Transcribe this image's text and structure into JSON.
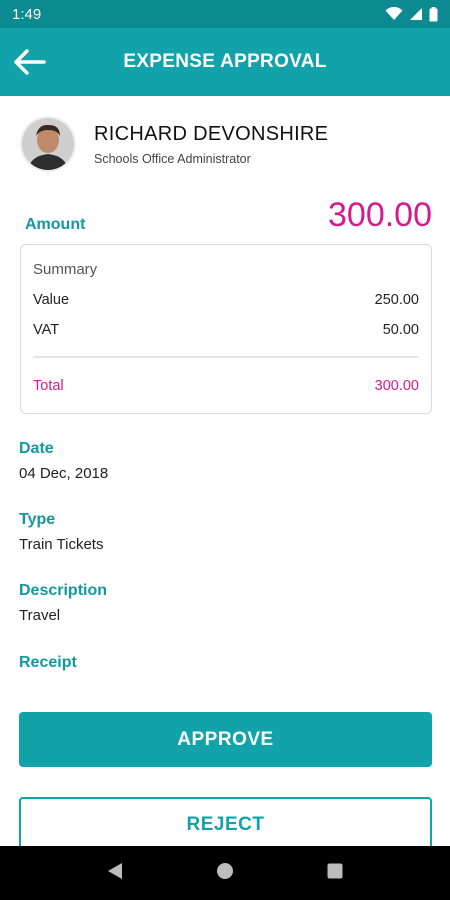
{
  "status_bar": {
    "time": "1:49"
  },
  "app_bar": {
    "title": "EXPENSE APPROVAL"
  },
  "profile": {
    "name": "RICHARD DEVONSHIRE",
    "role": "Schools Office Administrator"
  },
  "amount": {
    "label": "Amount",
    "value": "300.00"
  },
  "summary": {
    "title": "Summary",
    "rows": [
      {
        "label": "Value",
        "value": "250.00"
      },
      {
        "label": "VAT",
        "value": "50.00"
      }
    ],
    "total": {
      "label": "Total",
      "value": "300.00"
    }
  },
  "fields": {
    "date": {
      "label": "Date",
      "value": "04 Dec, 2018"
    },
    "type": {
      "label": "Type",
      "value": "Train Tickets"
    },
    "description": {
      "label": "Description",
      "value": "Travel"
    },
    "receipt": {
      "label": "Receipt"
    }
  },
  "actions": {
    "approve": "APPROVE",
    "reject": "REJECT"
  },
  "colors": {
    "primary": "#12a3aa",
    "status_bar": "#0b8a91",
    "accent": "#d21c8e",
    "label": "#13989f"
  },
  "icons": [
    "back-arrow-icon",
    "wifi-icon",
    "cellular-signal-icon",
    "battery-icon",
    "nav-back-icon",
    "nav-home-icon",
    "nav-recents-icon"
  ]
}
